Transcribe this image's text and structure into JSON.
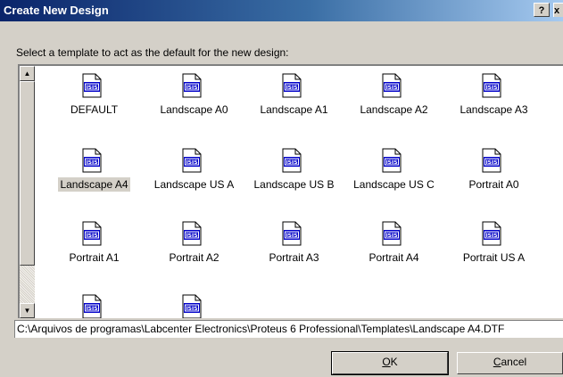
{
  "window": {
    "title": "Create New Design",
    "help_label": "?",
    "close_label": "x"
  },
  "prompt": "Select a template to act as the default for the new design:",
  "templates": [
    {
      "label": "DEFAULT",
      "selected": false
    },
    {
      "label": "Landscape A0",
      "selected": false
    },
    {
      "label": "Landscape A1",
      "selected": false
    },
    {
      "label": "Landscape A2",
      "selected": false
    },
    {
      "label": "Landscape A3",
      "selected": false
    },
    {
      "label": "Landscape A4",
      "selected": true
    },
    {
      "label": "Landscape US A",
      "selected": false
    },
    {
      "label": "Landscape US B",
      "selected": false
    },
    {
      "label": "Landscape US C",
      "selected": false
    },
    {
      "label": "Portrait A0",
      "selected": false
    },
    {
      "label": "Portrait A1",
      "selected": false
    },
    {
      "label": "Portrait A2",
      "selected": false
    },
    {
      "label": "Portrait A3",
      "selected": false
    },
    {
      "label": "Portrait A4",
      "selected": false
    },
    {
      "label": "Portrait US A",
      "selected": false
    },
    {
      "label": "",
      "selected": false
    },
    {
      "label": "",
      "selected": false
    }
  ],
  "template_icon": "isis-template-file-icon",
  "path": "C:\\Arquivos de programas\\Labcenter Electronics\\Proteus 6 Professional\\Templates\\Landscape A4.DTF",
  "buttons": {
    "ok_underline": "O",
    "ok_rest": "K",
    "cancel_underline": "C",
    "cancel_rest": "ancel"
  },
  "colors": {
    "title_start": "#0a246a",
    "title_end": "#a6caf0",
    "dialog_face": "#d4d0c8",
    "icon_blue": "#0000c8"
  }
}
